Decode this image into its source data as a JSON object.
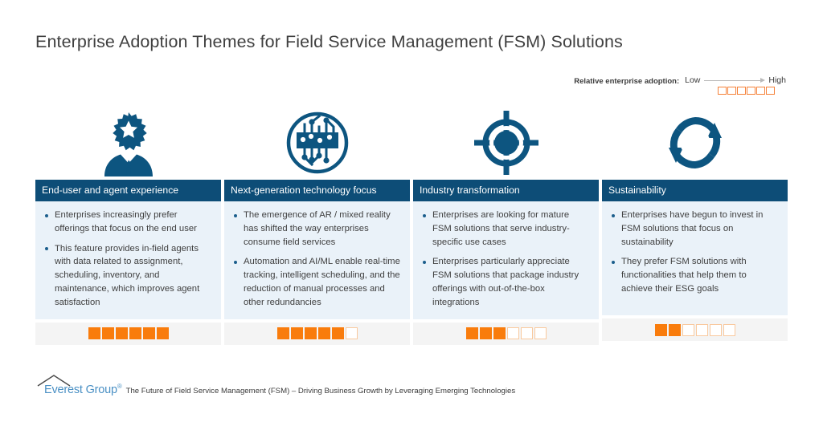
{
  "page": {
    "title": "Enterprise Adoption Themes for Field Service Management (FSM) Solutions",
    "accent_blue": "#0d4d77",
    "panel_blue": "#eaf2f9",
    "accent_orange": "#f97c0c",
    "strip_gray": "#f4f4f4"
  },
  "legend": {
    "label": "Relative enterprise adoption:",
    "low": "Low",
    "high": "High",
    "scale_total": 6,
    "scale_filled": 0
  },
  "columns": [
    {
      "icon": "person-badge-star-icon",
      "header": "End-user and agent experience",
      "bullets": [
        "Enterprises increasingly prefer offerings that focus on the end user",
        "This feature provides in-field agents with data related to assignment, scheduling, inventory, and maintenance, which improves agent satisfaction"
      ],
      "rating_total": 6,
      "rating_filled": 6
    },
    {
      "icon": "circuit-board-icon",
      "header": "Next-generation technology focus",
      "bullets": [
        "The emergence of AR / mixed reality has shifted the way enterprises consume field services",
        "Automation and AI/ML enable real-time tracking, intelligent scheduling, and the reduction of manual processes and other redundancies"
      ],
      "rating_total": 6,
      "rating_filled": 5
    },
    {
      "icon": "target-crosshair-icon",
      "header": "Industry transformation",
      "bullets": [
        "Enterprises are looking for mature FSM solutions that serve industry-specific use cases",
        "Enterprises particularly appreciate FSM solutions that package industry offerings with out-of-the-box integrations"
      ],
      "rating_total": 6,
      "rating_filled": 3
    },
    {
      "icon": "recycle-loop-icon",
      "header": "Sustainability",
      "bullets": [
        "Enterprises have begun to invest in FSM solutions that focus on sustainability",
        "They prefer FSM solutions with functionalities that help them to achieve their ESG goals"
      ],
      "rating_total": 6,
      "rating_filled": 2
    }
  ],
  "footer": {
    "logo_text": "Everest Group",
    "logo_mark": "®",
    "caption": "The Future of Field Service Management (FSM) – Driving Business Growth by Leveraging Emerging Technologies"
  }
}
